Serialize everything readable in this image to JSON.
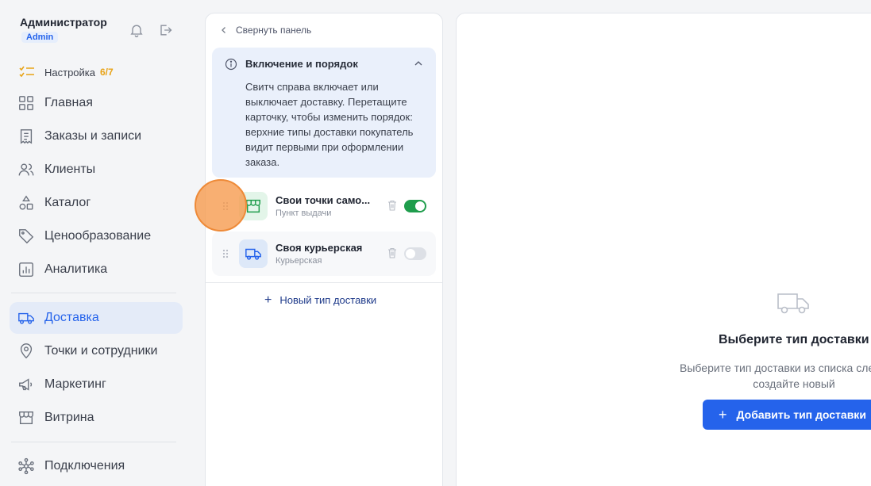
{
  "user": {
    "name": "Администратор",
    "role": "Admin"
  },
  "setup": {
    "label": "Настройка",
    "progress": "6/7"
  },
  "nav": [
    {
      "id": "home",
      "label": "Главная",
      "icon": "grid-icon"
    },
    {
      "id": "orders",
      "label": "Заказы и записи",
      "icon": "receipt-icon"
    },
    {
      "id": "clients",
      "label": "Клиенты",
      "icon": "users-icon"
    },
    {
      "id": "catalog",
      "label": "Каталог",
      "icon": "shapes-icon"
    },
    {
      "id": "pricing",
      "label": "Ценообразование",
      "icon": "tag-icon"
    },
    {
      "id": "analytics",
      "label": "Аналитика",
      "icon": "chart-icon"
    },
    {
      "id": "delivery",
      "label": "Доставка",
      "icon": "truck-icon",
      "active": true
    },
    {
      "id": "points",
      "label": "Точки и сотрудники",
      "icon": "location-pin-icon"
    },
    {
      "id": "marketing",
      "label": "Маркетинг",
      "icon": "megaphone-icon"
    },
    {
      "id": "storefront",
      "label": "Витрина",
      "icon": "store-icon"
    },
    {
      "id": "integrations",
      "label": "Подключения",
      "icon": "network-icon"
    }
  ],
  "panel": {
    "collapse_label": "Свернуть панель",
    "info": {
      "title": "Включение и порядок",
      "text": "Свитч справа включает или выключает доставку. Перетащите карточку, чтобы изменить порядок: верхние типы доставки покупатель видит первыми при оформлении заказа."
    },
    "delivery_types": [
      {
        "name": "Свои точки само...",
        "subtitle": "Пункт выдачи",
        "enabled": true,
        "icon": "store-icon",
        "tile_color": "#e3f5e9",
        "icon_color": "#1f9d4c"
      },
      {
        "name": "Своя курьерская",
        "subtitle": "Курьерская",
        "enabled": false,
        "icon": "truck-icon",
        "tile_color": "#dde8f8",
        "icon_color": "#2563eb"
      }
    ],
    "new_type_label": "Новый тип доставки"
  },
  "empty_state": {
    "title": "Выберите тип доставки",
    "subtitle": "Выберите тип доставки из списка слева или создайте новый",
    "button_label": "Добавить тип доставки"
  },
  "colors": {
    "accent": "#2563eb",
    "success": "#1f9d4c",
    "warning": "#e8a317"
  }
}
